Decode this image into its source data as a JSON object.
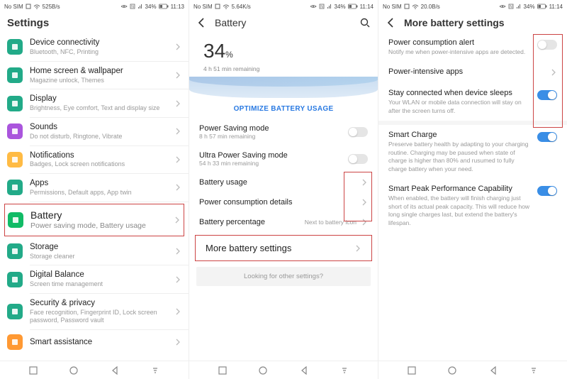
{
  "phone1": {
    "status": {
      "left": "No SIM",
      "speed": "525B/s",
      "batt": "34%",
      "time": "11:13"
    },
    "title": "Settings",
    "items": [
      {
        "icon": "#2a8",
        "label": "Device connectivity",
        "sub": "Bluetooth, NFC, Printing"
      },
      {
        "icon": "#2a8",
        "label": "Home screen & wallpaper",
        "sub": "Magazine unlock, Themes"
      },
      {
        "icon": "#2a8",
        "label": "Display",
        "sub": "Brightness, Eye comfort, Text and display size"
      },
      {
        "icon": "#a5d",
        "label": "Sounds",
        "sub": "Do not disturb, Ringtone, Vibrate"
      },
      {
        "icon": "#fb4",
        "label": "Notifications",
        "sub": "Badges, Lock screen notifications"
      },
      {
        "icon": "#2a8",
        "label": "Apps",
        "sub": "Permissions, Default apps, App twin"
      },
      {
        "icon": "#1b6",
        "label": "Battery",
        "sub": "Power saving mode, Battery usage",
        "selected": true
      },
      {
        "icon": "#2a8",
        "label": "Storage",
        "sub": "Storage cleaner"
      },
      {
        "icon": "#2a8",
        "label": "Digital Balance",
        "sub": "Screen time management"
      },
      {
        "icon": "#2a8",
        "label": "Security & privacy",
        "sub": "Face recognition, Fingerprint ID, Lock screen password, Password vault"
      },
      {
        "icon": "#f93",
        "label": "Smart assistance",
        "sub": ""
      }
    ]
  },
  "phone2": {
    "status": {
      "left": "No SIM",
      "speed": "5.64K/s",
      "batt": "34%",
      "time": "11:14"
    },
    "title": "Battery",
    "pct": "34",
    "pct_unit": "%",
    "remaining": "4 h 51 min remaining",
    "optimize": "OPTIMIZE BATTERY USAGE",
    "rows": [
      {
        "label": "Power Saving mode",
        "sub": "8 h 57 min remaining",
        "type": "toggle",
        "on": false
      },
      {
        "label": "Ultra Power Saving mode",
        "sub": "54 h 33 min remaining",
        "type": "toggle",
        "on": false
      },
      {
        "label": "Battery usage",
        "type": "link"
      },
      {
        "label": "Power consumption details",
        "type": "link"
      },
      {
        "label": "Battery percentage",
        "rtext": "Next to battery icon",
        "type": "link"
      }
    ],
    "more": "More battery settings",
    "search": "Looking for other settings?"
  },
  "phone3": {
    "status": {
      "left": "No SIM",
      "speed": "20.0B/s",
      "batt": "34%",
      "time": "11:14"
    },
    "title": "More battery settings",
    "rows": [
      {
        "label": "Power consumption alert",
        "sub": "Notify me when power-intensive apps are detected.",
        "type": "toggle",
        "on": false,
        "hl": true
      },
      {
        "label": "Power-intensive apps",
        "type": "link",
        "hl": true
      },
      {
        "label": "Stay connected when device sleeps",
        "sub": "Your WLAN or mobile data connection will stay on after the screen turns off.",
        "type": "toggle",
        "on": true,
        "hl": true
      },
      {
        "sep": true
      },
      {
        "label": "Smart Charge",
        "sub": "Preserve battery health by adapting to your charging routine. Charging may be paused when state of charge is higher than 80% and rusumed to fully charge battery when your need.",
        "type": "toggle",
        "on": true
      },
      {
        "label": "Smart Peak Performance Capability",
        "sub": "When enabled, the battery will finish charging just short of its actual peak capacity. This will reduce how long single charges last, but extend the battery's lifespan.",
        "type": "toggle",
        "on": true
      }
    ]
  }
}
